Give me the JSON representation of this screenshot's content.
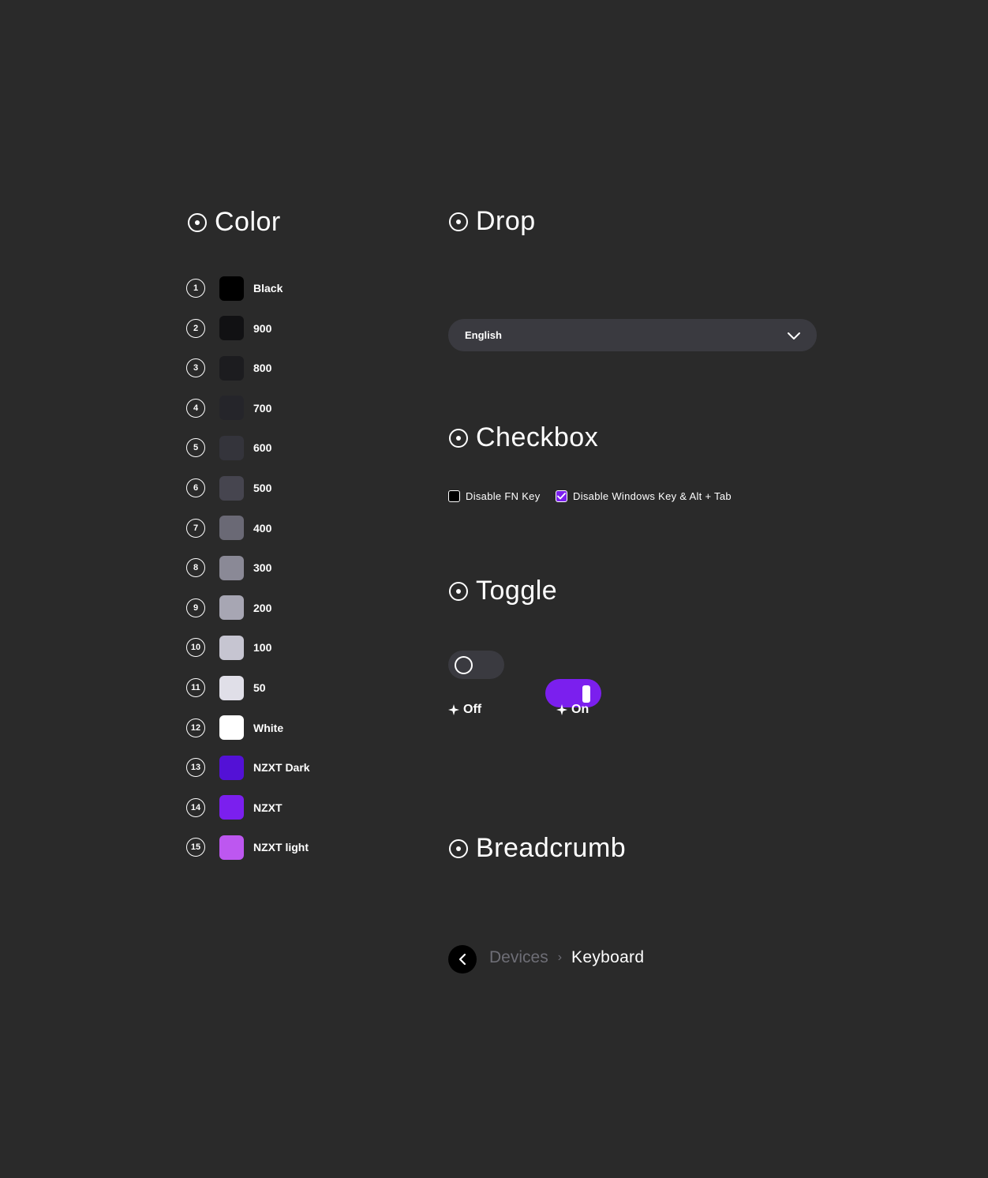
{
  "sections": {
    "color": "Color",
    "drop": "Drop",
    "checkbox": "Checkbox",
    "toggle": "Toggle",
    "breadcrumb": "Breadcrumb"
  },
  "colors": [
    {
      "num": "1",
      "label": "Black",
      "hex": "#000000"
    },
    {
      "num": "2",
      "label": "900",
      "hex": "#111113"
    },
    {
      "num": "3",
      "label": "800",
      "hex": "#1c1c1f"
    },
    {
      "num": "4",
      "label": "700",
      "hex": "#25252a"
    },
    {
      "num": "5",
      "label": "600",
      "hex": "#34343b"
    },
    {
      "num": "6",
      "label": "500",
      "hex": "#46454f"
    },
    {
      "num": "7",
      "label": "400",
      "hex": "#6a6975"
    },
    {
      "num": "8",
      "label": "300",
      "hex": "#8a8996"
    },
    {
      "num": "9",
      "label": "200",
      "hex": "#a7a6b3"
    },
    {
      "num": "10",
      "label": "100",
      "hex": "#c6c5d1"
    },
    {
      "num": "11",
      "label": "50",
      "hex": "#e0dfe8"
    },
    {
      "num": "12",
      "label": "White",
      "hex": "#ffffff"
    },
    {
      "num": "13",
      "label": "NZXT Dark",
      "hex": "#5311d6"
    },
    {
      "num": "14",
      "label": "NZXT",
      "hex": "#7b1fee"
    },
    {
      "num": "15",
      "label": "NZXT light",
      "hex": "#bd57f0"
    }
  ],
  "dropdown": {
    "value": "English"
  },
  "checkboxes": [
    {
      "label": "Disable FN Key",
      "checked": false
    },
    {
      "label": "Disable Windows Key & Alt + Tab",
      "checked": true
    }
  ],
  "toggles": [
    {
      "caption": "Off",
      "state": "off"
    },
    {
      "caption": "On",
      "state": "on"
    }
  ],
  "breadcrumb": {
    "parent": "Devices",
    "current": "Keyboard"
  },
  "accent": "#7b1fee"
}
